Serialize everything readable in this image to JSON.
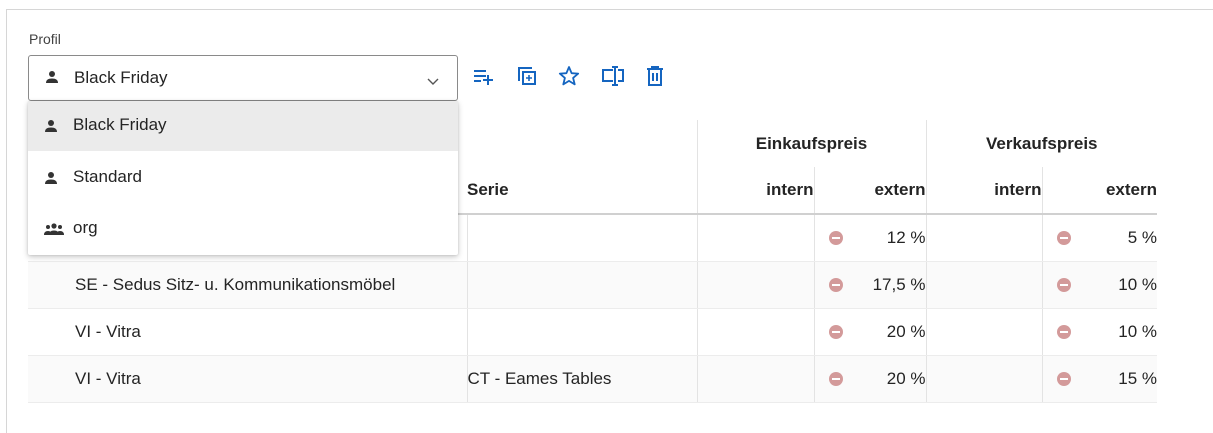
{
  "profile": {
    "label": "Profil",
    "selected": "Black Friday",
    "options": [
      {
        "label": "Black Friday",
        "icon": "person-icon",
        "selected": true
      },
      {
        "label": "Standard",
        "icon": "person-icon",
        "selected": false
      },
      {
        "label": "org",
        "icon": "group-icon",
        "selected": false
      }
    ]
  },
  "toolbar": {
    "icons": [
      "add-list-icon",
      "copy-icon",
      "star-icon",
      "rename-icon",
      "delete-icon"
    ],
    "accent": "#1565c0"
  },
  "table": {
    "group_headers": {
      "einkauf": "Einkaufspreis",
      "verkauf": "Verkaufspreis"
    },
    "columns": {
      "serie": "Serie",
      "ek_intern": "intern",
      "ek_extern": "extern",
      "vk_intern": "intern",
      "vk_extern": "extern"
    },
    "rows": [
      {
        "hersteller": "",
        "serie": "",
        "ek_intern": "",
        "ek_extern": "12 %",
        "vk_intern": "",
        "vk_extern": "5 %"
      },
      {
        "hersteller": "SE - Sedus Sitz- u. Kommunikationsmöbel",
        "serie": "",
        "ek_intern": "",
        "ek_extern": "17,5 %",
        "vk_intern": "",
        "vk_extern": "10 %"
      },
      {
        "hersteller": "VI - Vitra",
        "serie": "",
        "ek_intern": "",
        "ek_extern": "20 %",
        "vk_intern": "",
        "vk_extern": "10 %"
      },
      {
        "hersteller": "VI - Vitra",
        "serie": "CT - Eames Tables",
        "ek_intern": "",
        "ek_extern": "20 %",
        "vk_intern": "",
        "vk_extern": "15 %"
      }
    ],
    "colors": {
      "remove_badge": "#d39a9a",
      "header_line": "#d0d0d0"
    }
  }
}
